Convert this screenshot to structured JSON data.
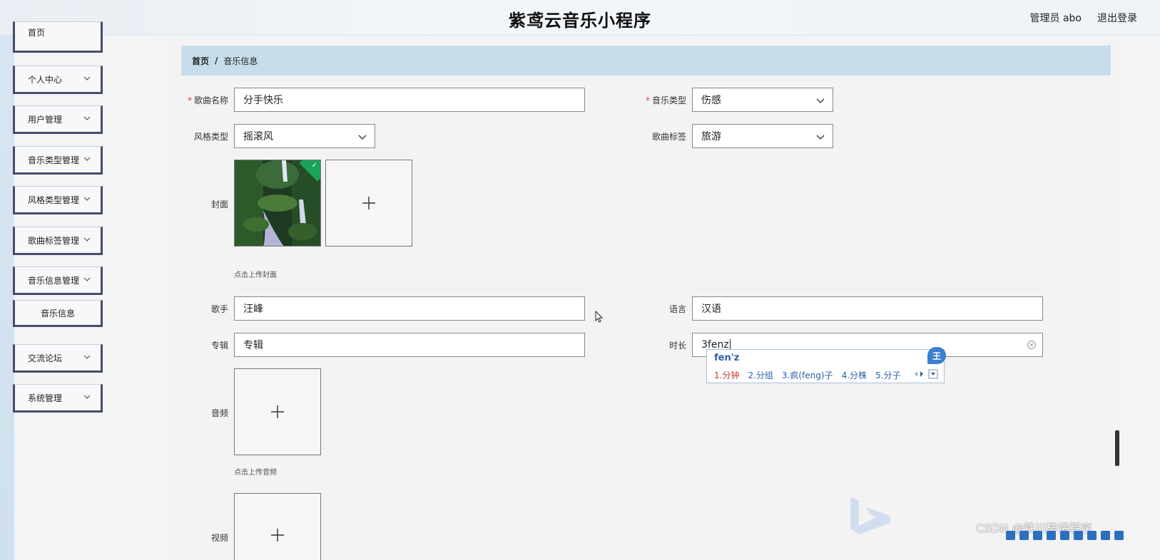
{
  "app": {
    "title": "紫鸢云音乐小程序",
    "user_label": "管理员 abo",
    "logout_label": "退出登录"
  },
  "sidebar": {
    "items": [
      {
        "label": "首页",
        "expandable": false
      },
      {
        "label": "个人中心",
        "expandable": true
      },
      {
        "label": "用户管理",
        "expandable": true
      },
      {
        "label": "音乐类型管理",
        "expandable": true
      },
      {
        "label": "风格类型管理",
        "expandable": true
      },
      {
        "label": "歌曲标签管理",
        "expandable": true
      },
      {
        "label": "音乐信息管理",
        "expandable": true
      },
      {
        "label": "交流论坛",
        "expandable": true
      },
      {
        "label": "系统管理",
        "expandable": true
      }
    ],
    "sub_item": "音乐信息"
  },
  "breadcrumb": {
    "home": "首页",
    "separator": "/",
    "current": "音乐信息"
  },
  "form": {
    "song_name": {
      "label": "歌曲名称",
      "required": true,
      "value": "分手快乐"
    },
    "music_type": {
      "label": "音乐类型",
      "required": true,
      "value": "伤感"
    },
    "style_type": {
      "label": "风格类型",
      "value": "摇滚风"
    },
    "song_tag": {
      "label": "歌曲标签",
      "value": "旅游"
    },
    "cover": {
      "label": "封面",
      "hint": "点击上传封面"
    },
    "singer": {
      "label": "歌手",
      "value": "汪峰"
    },
    "language": {
      "label": "语言",
      "value": "汉语"
    },
    "album": {
      "label": "专辑",
      "value": "专辑"
    },
    "duration": {
      "label": "时长",
      "value": "3fenz"
    },
    "audio": {
      "label": "音频",
      "hint": "点击上传音频"
    },
    "video": {
      "label": "视频"
    }
  },
  "ime": {
    "composition": "fen'z",
    "candidates": [
      "1.分钟",
      "2.分组",
      "3.疯(feng)子",
      "4.分株",
      "5.分子"
    ],
    "logo": "王"
  },
  "watermark": "CSDN @铁川毕设程序",
  "colors": {
    "breadcrumb_bg": "#c7dde9",
    "required": "#e23b3b",
    "success_badge": "#19a45a",
    "ime_text": "#2a5ea8"
  }
}
